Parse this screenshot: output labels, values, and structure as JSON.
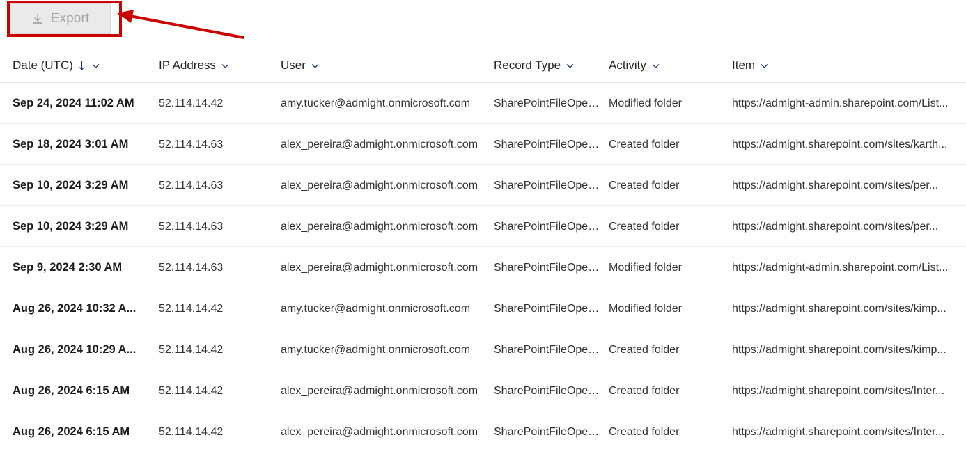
{
  "toolbar": {
    "export_label": "Export",
    "export_icon": "download-icon",
    "export_disabled": true
  },
  "annotation": {
    "highlight_color": "#cc0000",
    "shape": "rectangle-around-export-button",
    "arrow": "arrow-pointing-to-export-button"
  },
  "table": {
    "columns": [
      {
        "key": "date",
        "label": "Date (UTC)",
        "sorted": true,
        "sort_direction": "descending",
        "has_filter": true
      },
      {
        "key": "ip",
        "label": "IP Address",
        "sorted": false,
        "has_filter": true
      },
      {
        "key": "user",
        "label": "User",
        "sorted": false,
        "has_filter": true
      },
      {
        "key": "record",
        "label": "Record Type",
        "sorted": false,
        "has_filter": true
      },
      {
        "key": "activity",
        "label": "Activity",
        "sorted": false,
        "has_filter": true
      },
      {
        "key": "item",
        "label": "Item",
        "sorted": false,
        "has_filter": true
      }
    ],
    "rows": [
      {
        "date": "Sep 24, 2024 11:02 AM",
        "ip": "52.114.14.42",
        "user": "amy.tucker@admight.onmicrosoft.com",
        "record": "SharePointFileOper...",
        "activity": "Modified folder",
        "item": "https://admight-admin.sharepoint.com/List..."
      },
      {
        "date": "Sep 18, 2024 3:01 AM",
        "ip": "52.114.14.63",
        "user": "alex_pereira@admight.onmicrosoft.com",
        "record": "SharePointFileOper...",
        "activity": "Created folder",
        "item": "https://admight.sharepoint.com/sites/karth..."
      },
      {
        "date": "Sep 10, 2024 3:29 AM",
        "ip": "52.114.14.63",
        "user": "alex_pereira@admight.onmicrosoft.com",
        "record": "SharePointFileOper...",
        "activity": "Created folder",
        "item": "https://admight.sharepoint.com/sites/per..."
      },
      {
        "date": "Sep 10, 2024 3:29 AM",
        "ip": "52.114.14.63",
        "user": "alex_pereira@admight.onmicrosoft.com",
        "record": "SharePointFileOper...",
        "activity": "Created folder",
        "item": "https://admight.sharepoint.com/sites/per..."
      },
      {
        "date": "Sep 9, 2024 2:30 AM",
        "ip": "52.114.14.63",
        "user": "alex_pereira@admight.onmicrosoft.com",
        "record": "SharePointFileOper...",
        "activity": "Modified folder",
        "item": "https://admight-admin.sharepoint.com/List..."
      },
      {
        "date": "Aug 26, 2024 10:32 A...",
        "ip": "52.114.14.42",
        "user": "amy.tucker@admight.onmicrosoft.com",
        "record": "SharePointFileOper...",
        "activity": "Modified folder",
        "item": "https://admight.sharepoint.com/sites/kimp..."
      },
      {
        "date": "Aug 26, 2024 10:29 A...",
        "ip": "52.114.14.42",
        "user": "amy.tucker@admight.onmicrosoft.com",
        "record": "SharePointFileOper...",
        "activity": "Created folder",
        "item": "https://admight.sharepoint.com/sites/kimp..."
      },
      {
        "date": "Aug 26, 2024 6:15 AM",
        "ip": "52.114.14.42",
        "user": "alex_pereira@admight.onmicrosoft.com",
        "record": "SharePointFileOper...",
        "activity": "Created folder",
        "item": "https://admight.sharepoint.com/sites/Inter..."
      },
      {
        "date": "Aug 26, 2024 6:15 AM",
        "ip": "52.114.14.42",
        "user": "alex_pereira@admight.onmicrosoft.com",
        "record": "SharePointFileOper...",
        "activity": "Created folder",
        "item": "https://admight.sharepoint.com/sites/Inter..."
      }
    ]
  }
}
